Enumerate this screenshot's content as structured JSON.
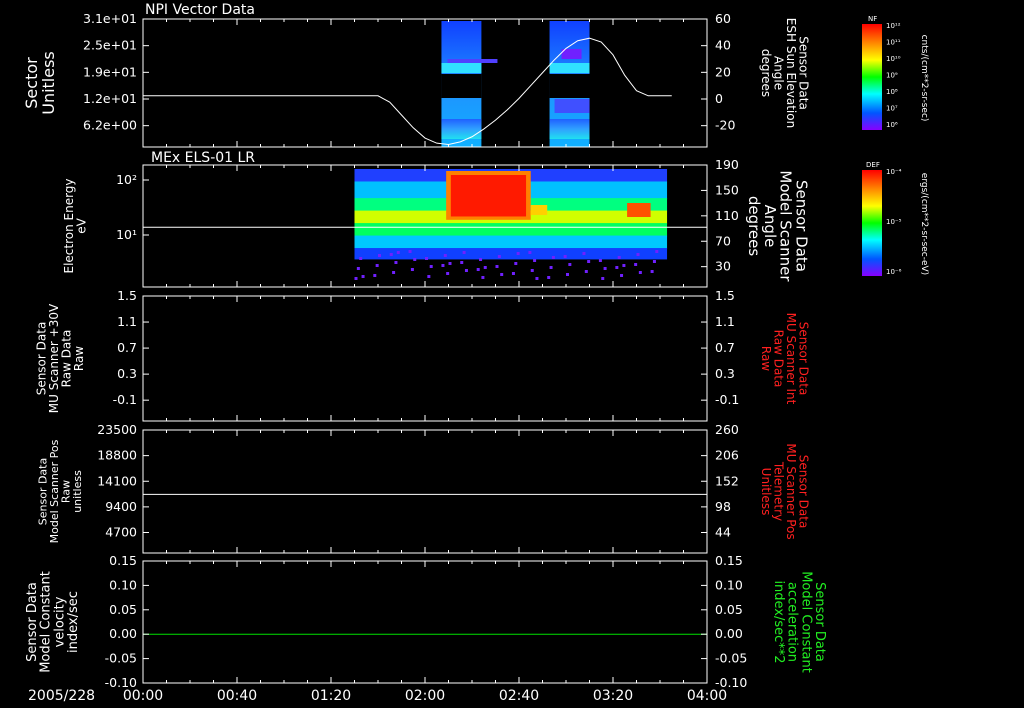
{
  "date_label": "2005/228",
  "time_axis": {
    "start_min": 0,
    "end_min": 240,
    "ticks": [
      {
        "min": 0,
        "label": "00:00"
      },
      {
        "min": 40,
        "label": "00:40"
      },
      {
        "min": 80,
        "label": "01:20"
      },
      {
        "min": 120,
        "label": "02:00"
      },
      {
        "min": 160,
        "label": "02:40"
      },
      {
        "min": 200,
        "label": "03:20"
      },
      {
        "min": 240,
        "label": "04:00"
      }
    ]
  },
  "chart_data": [
    {
      "type": "heatmap",
      "title": "NPI Vector Data",
      "ylabel_left": [
        "Sector",
        "Unitless"
      ],
      "ylabel_right": [
        "Sensor Data",
        "ESH Sun Elevation",
        "Angle",
        "degrees"
      ],
      "left_ticks": [
        "3.1e+01",
        "2.5e+01",
        "1.9e+01",
        "1.2e+01",
        "6.2e+00"
      ],
      "right_ylim": [
        -40,
        60
      ],
      "right_ticks": [
        "60",
        "40",
        "20",
        "0",
        "-20"
      ],
      "colorbar": {
        "label": "NF",
        "unit": "cnts/(cm**2-sr-sec)",
        "ticks": [
          "10¹²",
          "10¹¹",
          "10¹⁰",
          "10⁹",
          "10⁸",
          "10⁷",
          "10⁶"
        ],
        "colors": [
          "#ff0000",
          "#ff8800",
          "#ffff00",
          "#00ff00",
          "#00ffff",
          "#0055ff",
          "#8800ff"
        ]
      },
      "data_blocks_min": [
        [
          127,
          144
        ],
        [
          173,
          190
        ]
      ],
      "line_series": {
        "name": "ESH Sun Elevation",
        "x_min": [
          0,
          100,
          105,
          110,
          115,
          120,
          125,
          130,
          135,
          140,
          145,
          150,
          155,
          160,
          165,
          170,
          175,
          180,
          185,
          190,
          195,
          200,
          205,
          210,
          215,
          220,
          225
        ],
        "y": [
          0,
          0,
          -5,
          -15,
          -25,
          -33,
          -37,
          -38,
          -36,
          -32,
          -26,
          -19,
          -11,
          -2,
          8,
          18,
          28,
          37,
          43,
          45,
          42,
          32,
          16,
          4,
          0,
          0,
          0
        ]
      }
    },
    {
      "type": "heatmap",
      "title": "MEx ELS-01 LR",
      "ylabel_left": [
        "Electron Energy",
        "eV"
      ],
      "ylabel_right": [
        "Sensor Data",
        "Model Scanner",
        "Angle",
        "degrees"
      ],
      "left_ticks": [
        "10²",
        "10¹"
      ],
      "right_ylim": [
        0,
        190
      ],
      "right_ticks": [
        "190",
        "150",
        "110",
        "70",
        "30"
      ],
      "colorbar": {
        "label": "DEF",
        "unit": "ergs/(cm**2-sr-sec-eV)",
        "ticks": [
          "10⁻⁴",
          "10⁻⁵",
          "10⁻⁶"
        ],
        "colors": [
          "#ff0000",
          "#ffff00",
          "#00ff00",
          "#00ffff",
          "#0000ff",
          "#8800ff"
        ]
      },
      "data_range_min": [
        90,
        223
      ],
      "line_series": {
        "name": "Model Scanner Angle",
        "x_min": [
          0,
          240
        ],
        "y": [
          93,
          93
        ]
      }
    },
    {
      "type": "line",
      "ylabel_left": [
        "Sensor Data",
        "MU Scanner +30V",
        "Raw Data",
        "Raw"
      ],
      "ylabel_right": [
        "Sensor Data",
        "MU Scanner Int",
        "Raw Data",
        "Raw"
      ],
      "left_ticks": [
        "1.5",
        "1.1",
        "0.7",
        "0.3",
        "-0.1"
      ],
      "right_ticks": [
        "1.5",
        "1.1",
        "0.7",
        "0.3",
        "-0.1"
      ],
      "ylim": [
        -0.35,
        1.5
      ]
    },
    {
      "type": "line",
      "ylabel_left": [
        "Sensor Data",
        "Model Scanner Pos",
        "Raw",
        "unitless"
      ],
      "ylabel_right": [
        "Sensor Data",
        "MU Scanner Pos",
        "Telemetry",
        "Unitless"
      ],
      "left_ticks": [
        "23500",
        "18800",
        "14100",
        "9400",
        "4700"
      ],
      "right_ticks": [
        "260",
        "206",
        "152",
        "98",
        "44"
      ],
      "ylim": [
        0,
        23500
      ],
      "line_series": {
        "name": "Model Scanner Pos",
        "x_min": [
          0,
          240
        ],
        "y": [
          11200,
          11200
        ]
      }
    },
    {
      "type": "line",
      "ylabel_left": [
        "Sensor Data",
        "Model Constant",
        "velocity",
        "index/sec"
      ],
      "ylabel_right": [
        "Sensor Data",
        "Model Constant",
        "acceleration",
        "index/sec**2"
      ],
      "left_ticks": [
        "0.15",
        "0.10",
        "0.05",
        "0.00",
        "-0.05",
        "-0.10"
      ],
      "right_ticks": [
        "0.15",
        "0.10",
        "0.05",
        "0.00",
        "-0.05",
        "-0.10"
      ],
      "ylim": [
        -0.1,
        0.15
      ],
      "line_series": {
        "name": "Model Constant velocity",
        "x_min": [
          0,
          240
        ],
        "y": [
          0,
          0
        ]
      }
    }
  ]
}
